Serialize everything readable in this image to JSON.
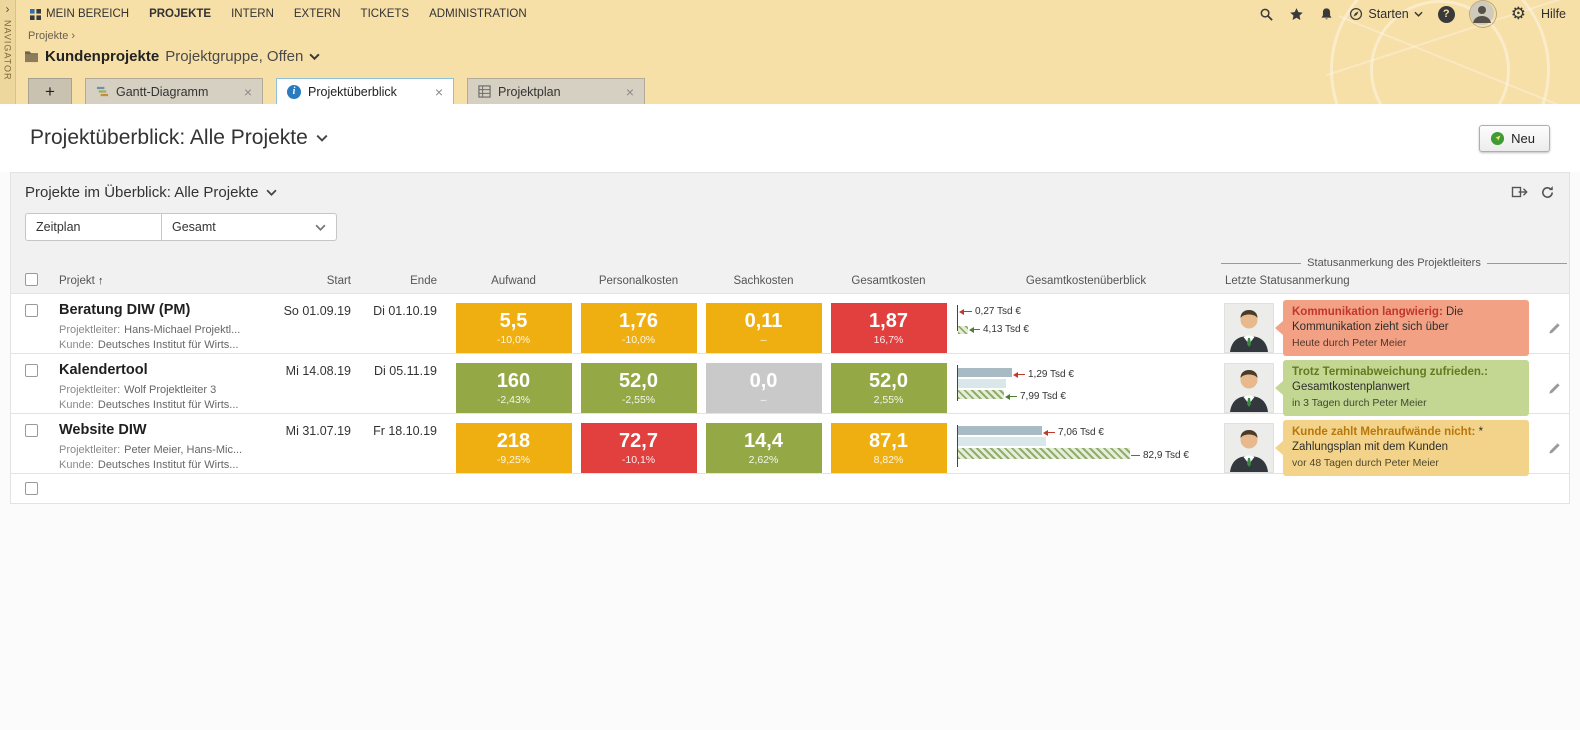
{
  "navigator_label": "NAVIGATOR",
  "topnav": {
    "items": [
      "MEIN BEREICH",
      "PROJEKTE",
      "INTERN",
      "EXTERN",
      "TICKETS",
      "ADMINISTRATION"
    ],
    "active": "PROJEKTE",
    "starten_label": "Starten",
    "hilfe_label": "Hilfe"
  },
  "breadcrumb": {
    "root": "Projekte",
    "separator": "›"
  },
  "context_header": {
    "title": "Kundenprojekte",
    "subtitle": "Projektgruppe, Offen"
  },
  "tabs": {
    "add_glyph": "+",
    "close_glyph": "×",
    "items": [
      {
        "label": "Gantt-Diagramm",
        "active": false
      },
      {
        "label": "Projektüberblick",
        "active": true
      },
      {
        "label": "Projektplan",
        "active": false
      }
    ]
  },
  "page": {
    "title": "Projektüberblick: Alle Projekte",
    "new_button_label": "Neu"
  },
  "panel": {
    "title": "Projekte im Überblick: Alle Projekte",
    "filter_left": "Zeitplan",
    "filter_right": "Gesamt"
  },
  "table": {
    "group_header": "Statusanmerkung des Projektleiters",
    "sort_glyph": "↑",
    "columns": {
      "projekt": "Projekt",
      "start": "Start",
      "ende": "Ende",
      "aufwand": "Aufwand",
      "personalkosten": "Personalkosten",
      "sachkosten": "Sachkosten",
      "gesamtkosten": "Gesamtkosten",
      "ueberblick": "Gesamtkostenüberblick",
      "status": "Letzte Statusanmerkung"
    },
    "row_labels": {
      "projektleiter": "Projektleiter:",
      "kunde": "Kunde:"
    },
    "rows": [
      {
        "name": "Beratung DIW (PM)",
        "projektleiter": "Hans-Michael Projektl...",
        "kunde": "Deutsches Institut für Wirts...",
        "start": "So 01.09.19",
        "ende": "Di 01.10.19",
        "aufwand": {
          "value": "5,5",
          "delta": "-10,0%",
          "color": "#EFAF10"
        },
        "personalkosten": {
          "value": "1,76",
          "delta": "-10,0%",
          "color": "#EFAF10"
        },
        "sachkosten": {
          "value": "0,11",
          "delta": "–",
          "color": "#EFAF10"
        },
        "gesamtkosten": {
          "value": "1,87",
          "delta": "16,7%",
          "color": "#E2403E"
        },
        "overview": {
          "over_label": "0,27 Tsd €",
          "plan_label": "4,13 Tsd €"
        },
        "status": {
          "title": "Kommunikation langwierig:",
          "body": " Die Kommunikation zieht sich über",
          "meta": "Heute durch Peter Meier",
          "bg": "#F2A184",
          "title_color": "#C2362B"
        }
      },
      {
        "name": "Kalendertool",
        "projektleiter": "Wolf Projektleiter 3",
        "kunde": "Deutsches Institut für Wirts...",
        "start": "Mi 14.08.19",
        "ende": "Di 05.11.19",
        "aufwand": {
          "value": "160",
          "delta": "-2,43%",
          "color": "#94A845"
        },
        "personalkosten": {
          "value": "52,0",
          "delta": "-2,55%",
          "color": "#94A845"
        },
        "sachkosten": {
          "value": "0,0",
          "delta": "–",
          "color": "#C9C9C9"
        },
        "gesamtkosten": {
          "value": "52,0",
          "delta": "2,55%",
          "color": "#94A845"
        },
        "overview": {
          "over_label": "1,29 Tsd €",
          "plan_label": "7,99 Tsd €"
        },
        "status": {
          "title": "Trotz Terminabweichung zufrieden.:",
          "body": " Gesamtkostenplanwert",
          "meta": "in 3 Tagen durch Peter Meier",
          "bg": "#C3D793",
          "title_color": "#637A1E"
        }
      },
      {
        "name": "Website DIW",
        "projektleiter": "Peter Meier, Hans-Mic...",
        "kunde": "Deutsches Institut für Wirts...",
        "start": "Mi 31.07.19",
        "ende": "Fr 18.10.19",
        "aufwand": {
          "value": "218",
          "delta": "-9,25%",
          "color": "#EFAF10"
        },
        "personalkosten": {
          "value": "72,7",
          "delta": "-10,1%",
          "color": "#E2403E"
        },
        "sachkosten": {
          "value": "14,4",
          "delta": "2,62%",
          "color": "#94A845"
        },
        "gesamtkosten": {
          "value": "87,1",
          "delta": "8,82%",
          "color": "#EFAF10"
        },
        "overview": {
          "over_label": "7,06 Tsd €",
          "plan_label": "82,9 Tsd €"
        },
        "status": {
          "title": "Kunde zahlt Mehraufwände nicht:",
          "body": " * Zahlungsplan mit dem Kunden",
          "meta": "vor 48 Tagen durch Peter Meier",
          "bg": "#F2D389",
          "title_color": "#B8770B"
        }
      }
    ]
  }
}
